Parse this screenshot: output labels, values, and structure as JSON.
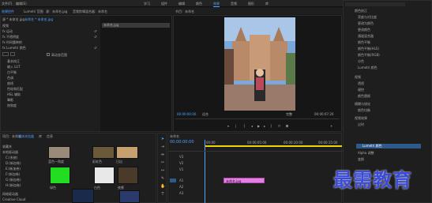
{
  "menu": [
    "文件(F)",
    "编辑(E)",
    "剪辑(C)",
    "序列(S)",
    "标记(M)",
    "图形(G)",
    "视图(V)",
    "窗口(W)",
    "帮助(H)"
  ],
  "workspaces": [
    "学习",
    "组件",
    "编辑",
    "颜色",
    "效果",
    "音频",
    "图形",
    "库"
  ],
  "active_workspace": "效果",
  "top_tabs": [
    "效果控件",
    "Lumetri 范围",
    "源：未命名.jpg",
    "音频剪辑混合器：未命名"
  ],
  "effect_controls": {
    "source": "源 * 未命名.jpg",
    "seq": "未命名 * 未命名.jpg",
    "clip": "未命名.jpg",
    "sections": [
      "视频",
      "fx 运动",
      "fx 不透明度",
      "fx 时间重映射",
      "fx Lumetri 颜色"
    ],
    "props": [
      "基本校正",
      "输入 LUT",
      "白平衡",
      "色调",
      "曲线",
      "色轮和匹配",
      "HSL 辅助",
      "晕影",
      "饱和度"
    ],
    "checkbox": "高动态范围"
  },
  "program": {
    "title": "节目：未命名",
    "tc_left": "00:00:00:00",
    "fit": "适合",
    "quality": "完整",
    "tc_right": "00:00:07:20"
  },
  "project": {
    "title": "项目：未命名",
    "tabs": [
      "媒体浏览器",
      "库",
      "信息"
    ],
    "tree": [
      "收藏夹",
      "本地驱动器",
      "C:(系统)",
      "D:(新加卷)",
      "E:(新加卷)",
      "F:(新加卷)",
      "G:(新加卷)",
      "H:(新加卷)",
      "网络驱动器",
      "Creative Cloud"
    ],
    "thumbs": [
      "蓝色一角度",
      "五颜六色",
      "彩虹色",
      "日出",
      "日落",
      "绿色",
      "白色",
      "夜景"
    ]
  },
  "timeline": {
    "title": "未命名",
    "timecode": "00:00:00:00",
    "ruler": [
      "00:00",
      "00:00:05:00",
      "00:00:10:00",
      "00:00:15:00"
    ],
    "tracks_v": [
      "V3",
      "V2",
      "V1"
    ],
    "tracks_a": [
      "A1",
      "A2",
      "A3"
    ],
    "clip": "未命名.jpg"
  },
  "effects": {
    "items": [
      "颜色校正",
      "亮度与对比度",
      "更改为颜色",
      "更改颜色",
      "通道混合器",
      "颜色平衡",
      "颜色平衡(HLS)",
      "颜色平衡(RGB)",
      "分色",
      "Lumetri 颜色",
      "视频",
      "透视",
      "键控",
      "颜色替换",
      "模糊与锐化",
      "颜色均衡",
      "视频效果",
      "过时",
      "Lumetri 颜色",
      "Alpha 调整",
      "变换"
    ],
    "highlight": "Lumetri 颜色"
  },
  "watermark": "最需教育",
  "colors": {
    "accent": "#4da3ff",
    "clip": "#e77ee7",
    "watermark": "#3b4bd8"
  }
}
